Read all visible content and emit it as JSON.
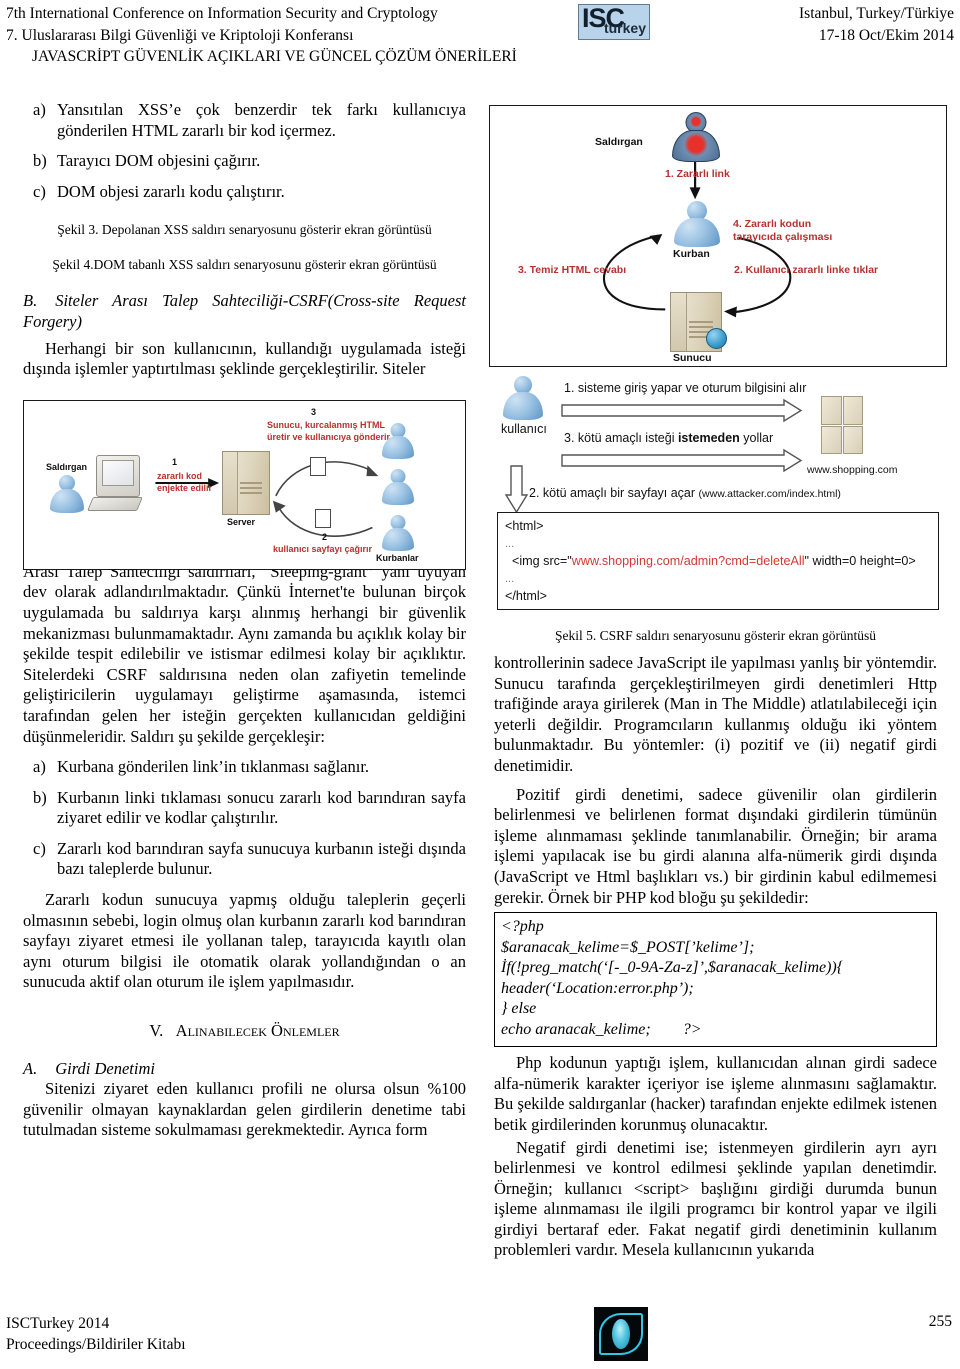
{
  "header": {
    "line1_en": "7th International Conference on Information Security and Cryptology",
    "line2_tr": "7. Uluslararası Bilgi Güvenliği ve Kriptoloji Konferansı",
    "paper_title": "JAVASCRİPT GÜVENLİK AÇIKLARI VE GÜNCEL ÇÖZÜM ÖNERİLERİ",
    "location": "Istanbul, Turkey/Türkiye",
    "dates": "17-18 Oct/Ekim 2014",
    "logo_isc": "ISC",
    "logo_turkey": "turkey"
  },
  "left_column": {
    "list_a": {
      "marker": "a)",
      "text": "Yansıtılan XSS’e çok benzerdir tek farkı kullanıcıya gönderilen HTML zararlı bir kod içermez."
    },
    "list_b": {
      "marker": "b)",
      "text": "Tarayıcı DOM objesini çağırır."
    },
    "list_c": {
      "marker": "c)",
      "text": "DOM objesi zararlı kodu çalıştırır."
    },
    "caption_fig3": "Şekil 3. Depolanan XSS saldırı senaryosunu gösterir ekran görüntüsü",
    "caption_fig4": "Şekil 4.DOM tabanlı XSS saldırı senaryosunu gösterir ekran görüntüsü",
    "section_b_label": "B.",
    "section_b_title": "Siteler Arası Talep Sahteciliği-CSRF(Cross-site Request Forgery)",
    "para_csrf_intro": "Herhangi bir son kullanıcının, kullandığı uygulamada isteği dışında işlemler yaptırtılması şeklinde gerçekleştirilir. Siteler",
    "para_sleeping_giant": "Arası Talep Sahteciliği saldırıları, “Sleeping-giant” yani uyuyan dev olarak adlandırılmaktadır. Çünkü İnternet'te bulunan birçok uygulamada bu saldırıya karşı alınmış herhangi bir güvenlik mekanizması bulunmamaktadır. Aynı zamanda bu açıklık kolay bir şekilde tespit edilebilir ve istismar edilmesi kolay bir açıklıktır. Sitelerdeki CSRF saldırısına neden olan zafiyetin temelinde geliştiricilerin uygulamayı geliştirme aşamasında, istemci tarafından gelen her isteğin gerçekten kullanıcıdan geldiğini düşünmeleridir. Saldırı şu şekilde gerçekleşir:",
    "attack_a": {
      "marker": "a)",
      "text": "Kurbana gönderilen link’in tıklanması sağlanır."
    },
    "attack_b": {
      "marker": "b)",
      "text": "Kurbanın linki tıklaması sonucu zararlı kod barındıran sayfa ziyaret edilir ve kodlar çalıştırılır."
    },
    "attack_c": {
      "marker": "c)",
      "text": "Zararlı kod barındıran sayfa sunucuya kurbanın isteği dışında bazı taleplerde bulunur."
    },
    "para_reason": "Zararlı kodun sunucuya yapmış olduğu taleplerin geçerli olmasının sebebi, login olmuş olan kurbanın zararlı kod barındıran sayfayı ziyaret etmesi ile yollanan talep, tarayıcıda kayıtlı olan aynı oturum bilgisi ile otomatik olarak yollandığından o an sunucuda aktif olan oturum ile işlem yapılmasıdır.",
    "section_v_num": "V.",
    "section_v_title": "Alınabilecek Önlemler",
    "section_a_label": "A.",
    "section_a_title": "Girdi Denetimi",
    "para_input_validation": "Sitenizi ziyaret eden kullanıcı profili ne olursa olsun %100 güvenilir olmayan kaynaklardan gelen girdilerin denetime tabi tutulmadan sisteme sokulmaması gerekmektedir. Ayrıca form"
  },
  "right_column": {
    "caption_fig5": "Şekil 5. CSRF saldırı senaryosunu gösterir ekran görüntüsü",
    "para_controls": "kontrollerinin sadece JavaScript ile yapılması yanlış bir yöntemdir. Sunucu tarafında gerçekleştirilmeyen girdi denetimleri Http trafiğinde araya girilerek (Man in The Middle) atlatılabileceği için yeterli değildir. Programcıların kullanmış olduğu iki yöntem bulunmaktadır. Bu yöntemler: (i) pozitif ve (ii) negatif girdi denetimidir.",
    "para_positive": "Pozitif girdi denetimi, sadece güvenilir olan girdilerin belirlenmesi ve belirlenen format dışındaki girdilerin tümünün işleme alınmaması şeklinde tanımlanabilir. Örneğin; bir arama işlemi yapılacak ise bu girdi alanına alfa-nümerik girdi dışında (JavaScript ve Html başlıkları vs.) bir girdinin kabul edilmemesi gerekir. Örnek bir PHP kod bloğu şu şekildedir:",
    "php_code": [
      "<?php",
      "$aranacak_kelime=$_POST[’kelime’];",
      "İf(!preg_match(‘[-_0-9A-Za-z]’,$aranacak_kelime)){",
      "header(‘Location:error.php’);",
      "} else",
      "echo aranacak_kelime;        ?>"
    ],
    "para_php_explain": "Php kodunun yaptığı işlem, kullanıcıdan alınan girdi sadece alfa-nümerik karakter içeriyor ise işleme alınmasını sağlamaktır. Bu şekilde saldırganlar (hacker) tarafından enjekte edilmek istenen betik girdilerinden korunmuş olunacaktır.",
    "para_negative": "Negatif girdi denetimi ise; istenmeyen girdilerin ayrı ayrı belirlenmesi ve kontrol edilmesi şeklinde yapılan denetimdir. Örneğin; kullanıcı <script> başlığını girdiği durumda bunun işleme alınmaması ile ilgili programcı bir kontrol yapar ve ilgili girdiyi bertaraf eder. Fakat negatif girdi denetiminin kullanım problemleri vardır. Mesela kullanıcının yukarıda"
  },
  "figure_dom_xss": {
    "actor_attacker": "Saldırgan",
    "actor_victim": "Kurban",
    "actor_server": "Sunucu",
    "step1": "1. Zararlı link",
    "step2": "2. Kullanıcı zararlı linke tıklar",
    "step3": "3. Temiz HTML cevabı",
    "step4_line1": "4. Zararlı kodun",
    "step4_line2": "tarayıcıda çalışması"
  },
  "figure_stored_xss": {
    "actor_attacker": "Saldırgan",
    "actor_server": "Server",
    "actor_victims": "Kurbanlar",
    "step1_num": "1",
    "step1_line1": "zararlı kod",
    "step1_line2": "enjekte edilir",
    "step2_num": "2",
    "step2_text": "kullanıcı sayfayı çağırır",
    "step3_num": "3",
    "step3_line1": "Sunucu, kurcalanmış HTML",
    "step3_line2": "üretir ve kullanıcıya gönderir"
  },
  "figure_csrf": {
    "actor_user": "kullanıcı",
    "server_domain": "www.shopping.com",
    "step1": "1. sisteme giriş yapar ve oturum bilgisini alır",
    "step3_pre": "3. kötü amaçlı isteği ",
    "step3_bold": "istemeden",
    "step3_post": " yollar",
    "step2": "2. kötü amaçlı bir sayfayı açar",
    "step2_url": "(www.attacker.com/index.html)",
    "html_lines": {
      "l1": "<html>",
      "l2": "...",
      "l3_pre": "  <img src=\"",
      "l3_red": "www.shopping.com/admin?cmd=deleteAll",
      "l3_post": "\" width=0 height=0>",
      "l4": "...",
      "l5": "</html>"
    }
  },
  "footer": {
    "line1": "ISCTurkey 2014",
    "line2": "Proceedings/Bildiriler Kitabı",
    "page_number": "255"
  }
}
